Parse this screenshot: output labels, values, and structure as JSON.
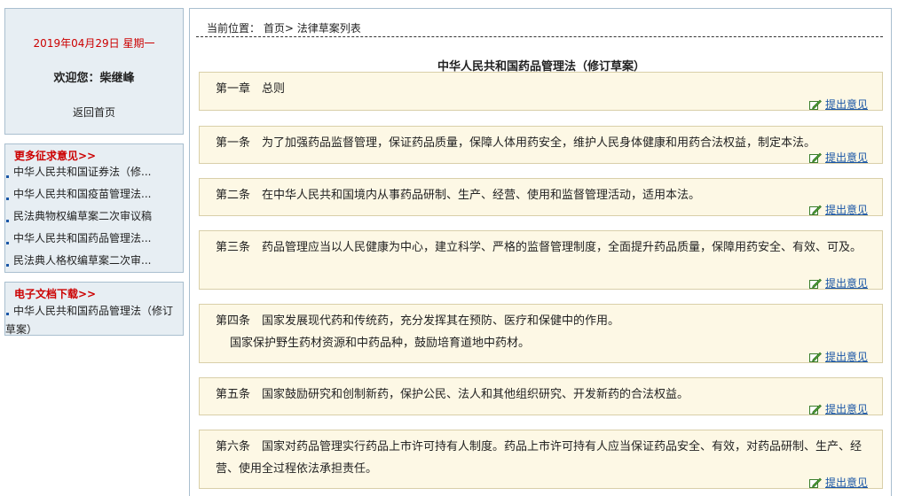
{
  "sidebar": {
    "date": "2019年04月29日 星期一",
    "welcome": "欢迎您：柴继峰",
    "home_link": "返回首页",
    "more_title": "更多征求意见>>",
    "more_items": [
      {
        "label": "中华人民共和国证券法（修..."
      },
      {
        "label": "中华人民共和国疫苗管理法..."
      },
      {
        "label": "民法典物权编草案二次审议稿"
      },
      {
        "label": "中华人民共和国药品管理法..."
      },
      {
        "label": "民法典人格权编草案二次审..."
      }
    ],
    "docs_title": "电子文档下载>>",
    "docs_items": [
      {
        "label": "中华人民共和国药品管理法（修订草案）"
      }
    ]
  },
  "main": {
    "breadcrumb": {
      "prefix": "当前位置：",
      "home": "首页",
      "separator": ">",
      "current": "法律草案列表"
    },
    "title": "中华人民共和国药品管理法（修订草案）",
    "suggest_label": "提出意见",
    "articles": [
      {
        "lines": [
          "第一章　总则"
        ]
      },
      {
        "lines": [
          "第一条　为了加强药品监督管理，保证药品质量，保障人体用药安全，维护人民身体健康和用药合法权益，制定本法。"
        ]
      },
      {
        "lines": [
          "第二条　在中华人民共和国境内从事药品研制、生产、经营、使用和监督管理活动，适用本法。"
        ]
      },
      {
        "lines": [
          "第三条　药品管理应当以人民健康为中心，建立科学、严格的监督管理制度，全面提升药品质量，保障用药安全、有效、可及。"
        ]
      },
      {
        "lines": [
          "第四条　国家发展现代药和传统药，充分发挥其在预防、医疗和保健中的作用。",
          "国家保护野生药材资源和中药品种，鼓励培育道地中药材。"
        ]
      },
      {
        "lines": [
          "第五条　国家鼓励研究和创制新药，保护公民、法人和其他组织研究、开发新药的合法权益。"
        ]
      },
      {
        "lines": [
          "第六条　国家对药品管理实行药品上市许可持有人制度。药品上市许可持有人应当保证药品安全、有效，对药品研制、生产、经营、使用全过程依法承担责任。"
        ]
      }
    ]
  },
  "icons": {
    "suggest": "pen-edit-icon"
  },
  "colors": {
    "accent_red": "#cc0000",
    "link_blue": "#1a56a6",
    "panel_bg": "#e7eef3",
    "panel_border": "#a9bfcf",
    "article_bg": "#fdf8e5",
    "article_border": "#d9cfa9"
  }
}
